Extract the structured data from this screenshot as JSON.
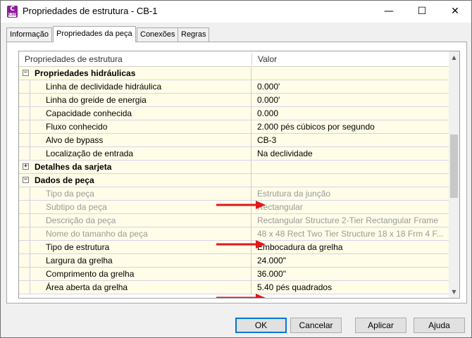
{
  "window": {
    "app_icon_letter": "C",
    "app_icon_sub": "C3D",
    "title": "Propriedades de estrutura - CB-1",
    "controls": {
      "minimize": "—",
      "maximize": "☐",
      "close": "✕"
    }
  },
  "tabs": [
    {
      "label": "Informação",
      "active": false
    },
    {
      "label": "Propriedades da peça",
      "active": true
    },
    {
      "label": "Conexões",
      "active": false
    },
    {
      "label": "Regras",
      "active": false
    }
  ],
  "grid": {
    "columns": [
      "Propriedades de estrutura",
      "Valor"
    ],
    "rows": [
      {
        "kind": "group",
        "expander": "−",
        "name": "Propriedades hidráulicas",
        "value": ""
      },
      {
        "kind": "child",
        "name": "Linha de declividade hidráulica",
        "value": "0.000'"
      },
      {
        "kind": "child",
        "name": "Linha do greide de energia",
        "value": "0.000'"
      },
      {
        "kind": "child",
        "name": "Capacidade conhecida",
        "value": "0.000"
      },
      {
        "kind": "child",
        "name": "Fluxo conhecido",
        "value": "2.000 pés cúbicos por segundo"
      },
      {
        "kind": "child",
        "name": "Alvo de bypass",
        "value": "CB-3"
      },
      {
        "kind": "child",
        "name": "Localização de entrada",
        "value": "Na declividade"
      },
      {
        "kind": "group",
        "expander": "+",
        "name": "Detalhes da sarjeta",
        "value": ""
      },
      {
        "kind": "group",
        "expander": "−",
        "name": "Dados de peça",
        "value": ""
      },
      {
        "kind": "child",
        "disabled": true,
        "name": "Tipo da peça",
        "value": "Estrutura da junção"
      },
      {
        "kind": "child",
        "disabled": true,
        "name": "Subtipo da peça",
        "value": "Rectangular"
      },
      {
        "kind": "child",
        "disabled": true,
        "name": "Descrição da peça",
        "value": "Rectangular Structure 2-Tier Rectangular Frame"
      },
      {
        "kind": "child",
        "disabled": true,
        "name": "Nome do tamanho da peça",
        "value": "48 x 48 Rect Two Tier Structure 18 x 18 Frm 4 F..."
      },
      {
        "kind": "child",
        "name": "Tipo de estrutura",
        "value": "Embocadura da grelha"
      },
      {
        "kind": "child",
        "name": "Largura da grelha",
        "value": "24.000\""
      },
      {
        "kind": "child",
        "name": "Comprimento da grelha",
        "value": "36.000\""
      },
      {
        "kind": "child",
        "name": "Área aberta da grelha",
        "value": "5.40 pés quadrados"
      }
    ]
  },
  "scrollbar": {
    "up": "▲",
    "down": "▼"
  },
  "buttons": {
    "ok": "OK",
    "cancel": "Cancelar",
    "apply": "Aplicar",
    "help": "Ajuda"
  },
  "annotation_color": "#e0191b"
}
